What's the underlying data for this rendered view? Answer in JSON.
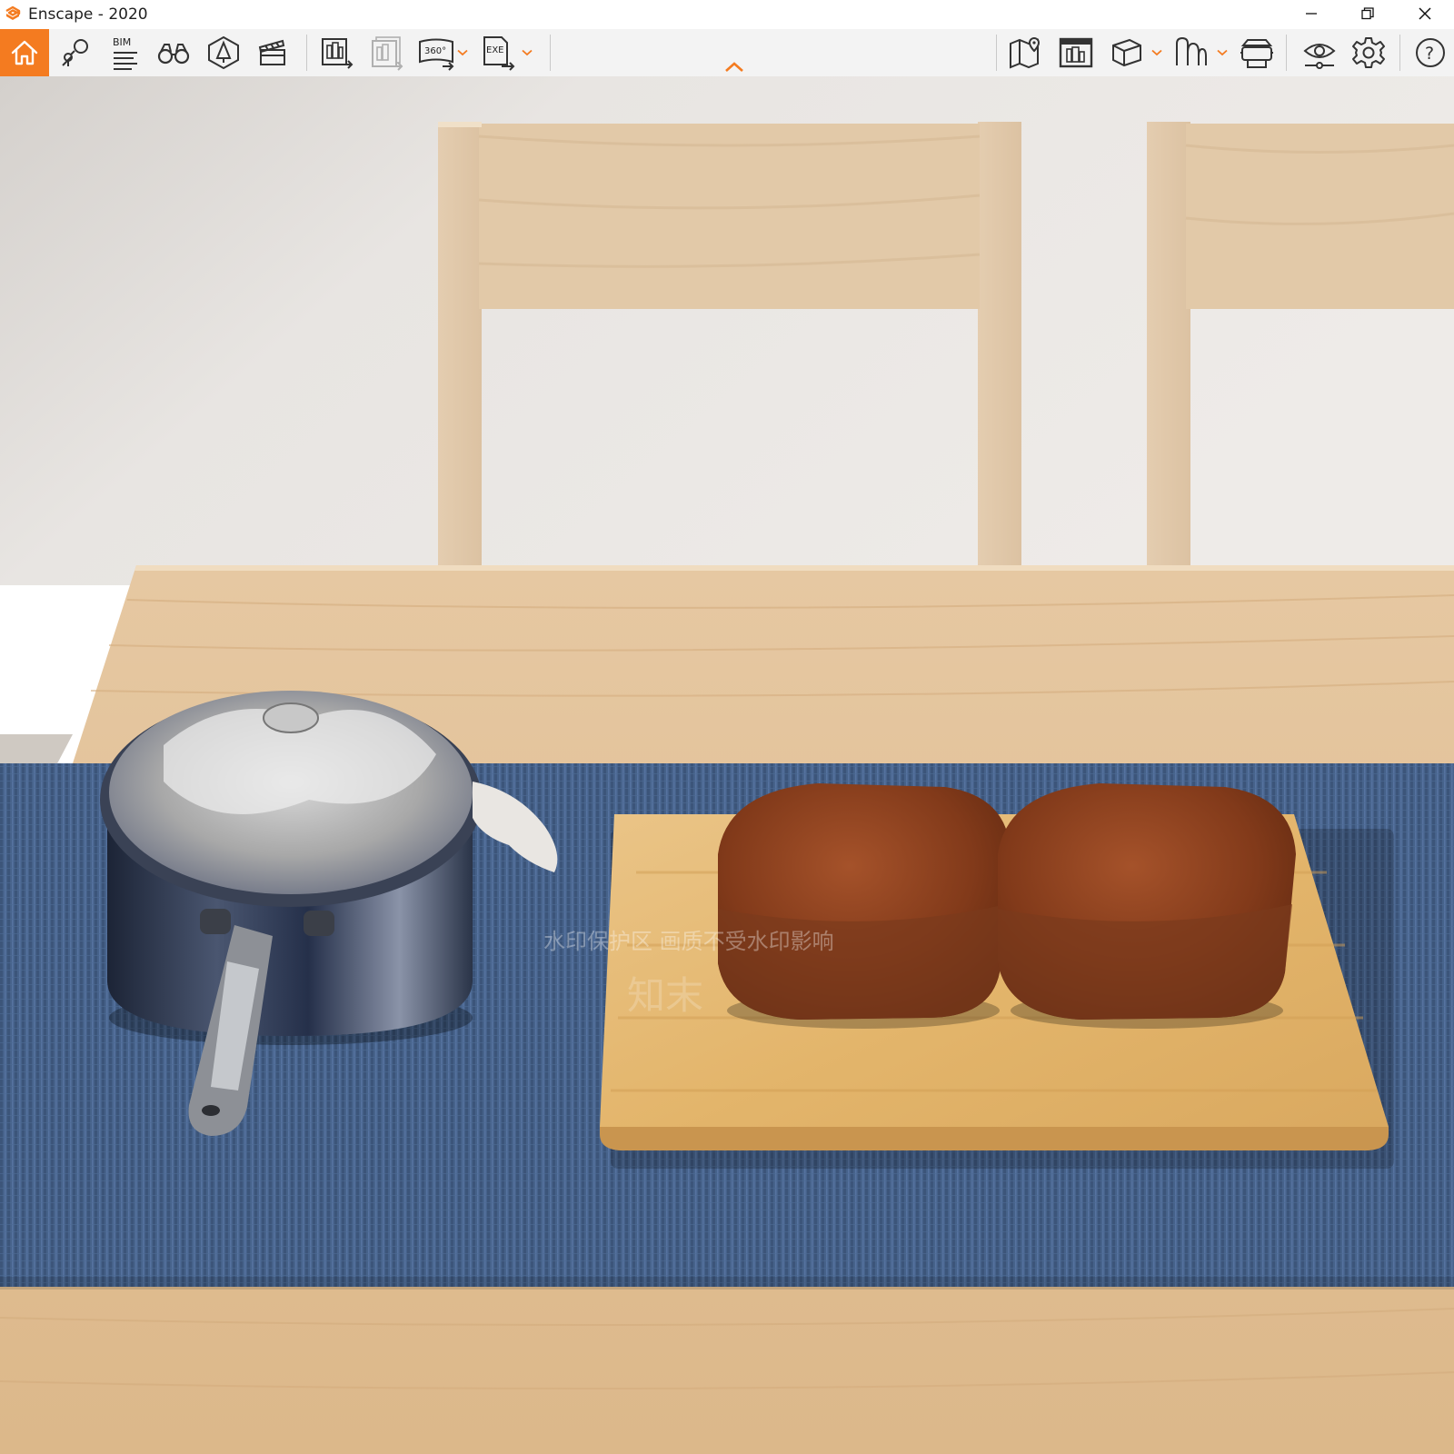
{
  "window": {
    "title": "Enscape - 2020",
    "logo_icon": "enscape-logo-icon",
    "controls": [
      "minimize-icon",
      "restore-icon",
      "close-icon"
    ]
  },
  "toolbar": {
    "accent_color": "#f47b20",
    "background_color": "#f3f3f3",
    "left_group": [
      {
        "name": "home-icon",
        "active": true
      },
      {
        "name": "views-pin-icon"
      },
      {
        "name": "bim-info-icon",
        "label": "BIM"
      },
      {
        "name": "binoculars-icon"
      },
      {
        "name": "asset-library-icon"
      },
      {
        "name": "video-editor-clapper-icon"
      },
      {
        "name": "screenshot-export-icon"
      },
      {
        "name": "batch-render-icon",
        "disabled": true
      },
      {
        "name": "panorama-360-icon",
        "label": "360°",
        "has_dropdown": true
      },
      {
        "name": "exe-export-icon",
        "label": "EXE",
        "has_dropdown": true
      }
    ],
    "right_group": [
      {
        "name": "map-pin-icon"
      },
      {
        "name": "render-window-icon"
      },
      {
        "name": "cube-view-icon",
        "has_dropdown": true
      },
      {
        "name": "walk-mode-icon",
        "has_dropdown": true
      },
      {
        "name": "vr-headset-icon"
      },
      {
        "name": "visual-settings-eye-icon"
      },
      {
        "name": "settings-gear-icon"
      },
      {
        "name": "help-icon",
        "label": "?"
      }
    ],
    "collapse_icon": "chevron-up-icon"
  },
  "viewport": {
    "scene": "rendered interior: wooden dining table with blue table runner, stainless saucepan with glass lid, bamboo cutting board with two loaves of bread, two wooden chairs",
    "watermark_lines": [
      "水印保护区  画质不受水印影响",
      "知末"
    ],
    "colors": {
      "wall": "#ebe8e5",
      "wood_light": "#e6cfb2",
      "wood_table": "#e3c39a",
      "runner": "#46628a",
      "board": "#e5ba73",
      "bread": "#8a3e1d"
    }
  }
}
